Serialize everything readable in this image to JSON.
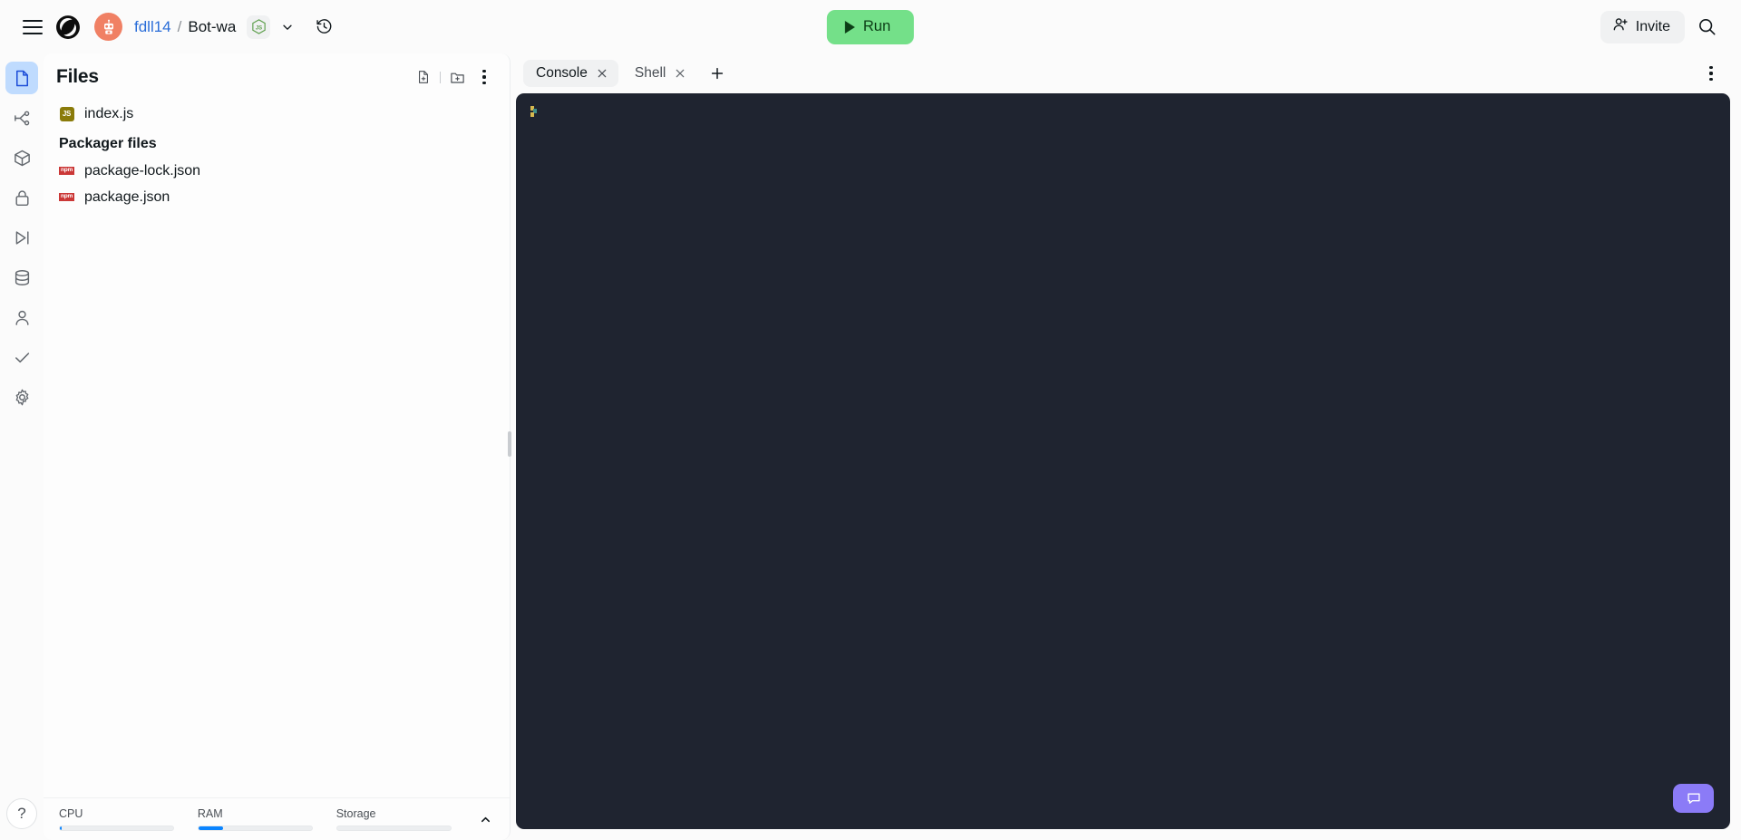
{
  "topbar": {
    "menu_icon": "hamburger-menu-icon",
    "logo_icon": "replit-logo-icon",
    "avatar_icon": "robot-avatar-icon",
    "breadcrumb": {
      "owner": "fdll14",
      "separator": "/",
      "repl_name": "Bot-wa"
    },
    "language_badge": "nodejs-icon",
    "language_chevron": "chevron-down-icon",
    "history_icon": "history-clock-icon",
    "run_label": "Run",
    "run_icon": "play-triangle-icon",
    "run_bg": "#74e089",
    "invite_label": "Invite",
    "invite_icon": "person-add-icon",
    "search_icon": "search-icon"
  },
  "rail": {
    "items": [
      {
        "name": "files",
        "icon": "file-icon",
        "active": true
      },
      {
        "name": "version-control",
        "icon": "git-branch-icon",
        "active": false
      },
      {
        "name": "packages",
        "icon": "cube-package-icon",
        "active": false
      },
      {
        "name": "secrets",
        "icon": "lock-icon",
        "active": false
      },
      {
        "name": "deployments",
        "icon": "deploy-play-icon",
        "active": false
      },
      {
        "name": "database",
        "icon": "database-icon",
        "active": false
      },
      {
        "name": "authentication",
        "icon": "user-icon",
        "active": false
      },
      {
        "name": "checks",
        "icon": "checkmark-icon",
        "active": false
      },
      {
        "name": "settings",
        "icon": "gear-icon",
        "active": false
      }
    ],
    "help_label": "?"
  },
  "files_panel": {
    "title": "Files",
    "actions": [
      {
        "name": "new-file",
        "icon": "new-file-icon"
      },
      {
        "name": "new-folder",
        "icon": "new-folder-icon"
      },
      {
        "name": "more-options",
        "icon": "kebab-menu-icon"
      }
    ],
    "entries": [
      {
        "label": "index.js",
        "icon": "js-file-icon",
        "badge": "JS",
        "type": "file"
      }
    ],
    "group_title": "Packager files",
    "packager_entries": [
      {
        "label": "package-lock.json",
        "icon": "npm-file-icon",
        "badge": "npm",
        "type": "file"
      },
      {
        "label": "package.json",
        "icon": "npm-file-icon",
        "badge": "npm",
        "type": "file"
      }
    ]
  },
  "resources": {
    "items": [
      {
        "label": "CPU",
        "percent": 2,
        "color": "#0a84ff"
      },
      {
        "label": "RAM",
        "percent": 22,
        "color": "#0a84ff"
      },
      {
        "label": "Storage",
        "percent": 0,
        "color": "#0a84ff"
      }
    ],
    "collapse_icon": "chevron-up-icon"
  },
  "console": {
    "tabs": [
      {
        "label": "Console",
        "active": true,
        "close_icon": "close-icon"
      },
      {
        "label": "Shell",
        "active": false,
        "close_icon": "close-icon"
      }
    ],
    "add_tab_icon": "plus-icon",
    "add_tab_label": "+",
    "kebab_icon": "kebab-menu-icon",
    "background": "#1f2430",
    "prompt_glyph": "shell-prompt-icon",
    "output_lines": [],
    "chat_icon": "chat-bubble-icon",
    "chat_bg": "#8b7bf7"
  }
}
